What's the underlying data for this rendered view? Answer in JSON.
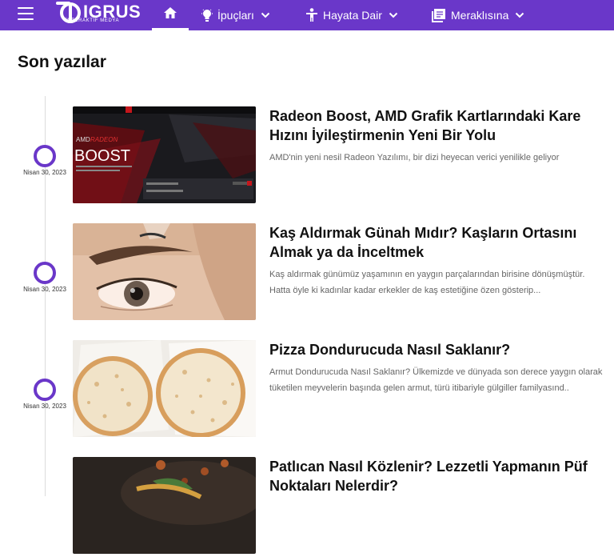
{
  "header": {
    "brand": "IGRUS",
    "brand_sub": "İNTERAKTİF MEDYA",
    "nav": [
      {
        "label": "İpuçları",
        "icon": "lightbulb-icon"
      },
      {
        "label": "Hayata Dair",
        "icon": "person-icon"
      },
      {
        "label": "Meraklısına",
        "icon": "book-icon"
      }
    ],
    "accent": "#6a37c9"
  },
  "main": {
    "heading": "Son yazılar",
    "posts": [
      {
        "date": "Nisan 30, 2023",
        "title": "Radeon Boost, AMD Grafik Kartlarındaki Kare Hızını İyileştirmenin Yeni Bir Yolu",
        "excerpt": "AMD'nin yeni nesil Radeon Yazılımı, bir dizi heyecan verici yenilikle geliyor",
        "thumb_text": "BOOST"
      },
      {
        "date": "Nisan 30, 2023",
        "title": "Kaş Aldırmak Günah Mıdır? Kaşların Ortasını Almak ya da İnceltmek",
        "excerpt": "Kaş aldırmak günümüz yaşamının en yaygın parçalarından birisine dönüşmüştür. Hatta öyle ki kadınlar kadar erkekler de kaş estetiğine özen gösterip..."
      },
      {
        "date": "Nisan 30, 2023",
        "title": "Pizza Dondurucuda Nasıl Saklanır?",
        "excerpt": "Armut Dondurucuda Nasıl Saklanır? Ülkemizde ve dünyada son derece yaygın olarak tüketilen meyvelerin başında gelen armut, türü itibariyle gülgiller familyasınd.."
      },
      {
        "date": "",
        "title": "Patlıcan Nasıl Közlenir? Lezzetli Yapmanın Püf Noktaları Nelerdir?",
        "excerpt": ""
      }
    ]
  }
}
